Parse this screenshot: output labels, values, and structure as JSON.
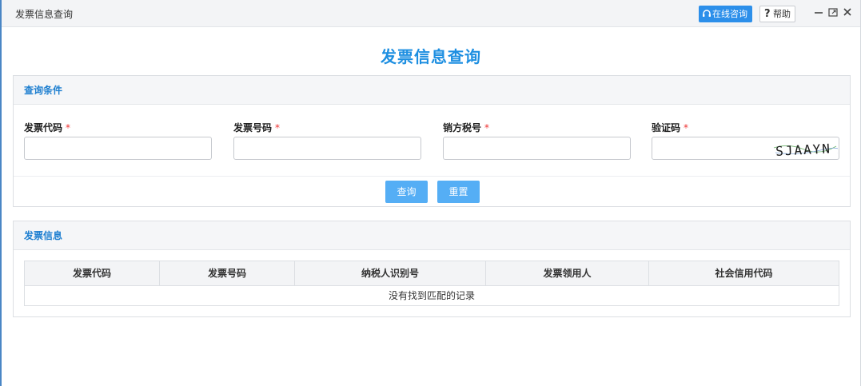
{
  "window": {
    "title": "发票信息查询",
    "consult_label": "在线咨询",
    "help_label": "帮助"
  },
  "page": {
    "title": "发票信息查询"
  },
  "query_panel": {
    "title": "查询条件",
    "fields": [
      {
        "label": "发票代码",
        "required": "*",
        "value": ""
      },
      {
        "label": "发票号码",
        "required": "*",
        "value": ""
      },
      {
        "label": "销方税号",
        "required": "*",
        "value": ""
      },
      {
        "label": "验证码",
        "required": "*",
        "value": ""
      }
    ],
    "captcha_text": "SJAAYN",
    "search_label": "查询",
    "reset_label": "重置"
  },
  "result_panel": {
    "title": "发票信息",
    "columns": [
      "发票代码",
      "发票号码",
      "纳税人识别号",
      "发票领用人",
      "社会信用代码"
    ],
    "empty_text": "没有找到匹配的记录"
  },
  "colors": {
    "accent": "#1e8fe1",
    "button": "#55aef5",
    "required": "#e33333"
  }
}
